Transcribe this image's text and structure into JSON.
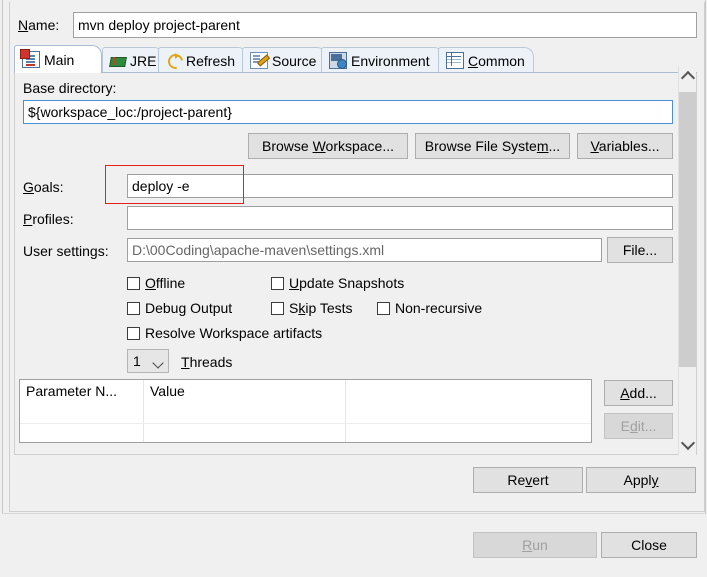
{
  "dialog": {
    "name_label": "Name:",
    "name_value": "mvn deploy project-parent"
  },
  "tabs": [
    {
      "label": "Main",
      "icon": "main-tab-icon",
      "selected": true
    },
    {
      "label": "JRE",
      "icon": "jre-tab-icon",
      "selected": false
    },
    {
      "label": "Refresh",
      "icon": "refresh-tab-icon",
      "selected": false
    },
    {
      "label": "Source",
      "icon": "source-tab-icon",
      "selected": false
    },
    {
      "label": "Environment",
      "icon": "environment-tab-icon",
      "selected": false
    },
    {
      "label": "Common",
      "icon": "common-tab-icon",
      "selected": false
    }
  ],
  "main_tab": {
    "base_directory_label": "Base directory:",
    "base_directory_value": "${workspace_loc:/project-parent}",
    "browse_workspace_label": "Browse Workspace...",
    "browse_file_system_label": "Browse File System...",
    "variables_label": "Variables...",
    "goals_label": "Goals:",
    "goals_value": "deploy -e",
    "profiles_label": "Profiles:",
    "profiles_value": "",
    "user_settings_label": "User settings:",
    "user_settings_value": "D:\\00Coding\\apache-maven\\settings.xml",
    "file_button_label": "File...",
    "checkboxes": [
      {
        "label": "Offline",
        "checked": false
      },
      {
        "label": "Update Snapshots",
        "checked": false
      },
      {
        "label": "Debug Output",
        "checked": false
      },
      {
        "label": "Skip Tests",
        "checked": false
      },
      {
        "label": "Non-recursive",
        "checked": false
      },
      {
        "label": "Resolve Workspace artifacts",
        "checked": false
      }
    ],
    "threads_value": "1",
    "threads_label": "Threads",
    "parameters_table": {
      "columns": [
        "Parameter N...",
        "Value",
        ""
      ],
      "rows": []
    },
    "add_button_label": "Add...",
    "edit_button_label": "Edit...",
    "edit_button_enabled": false
  },
  "footer": {
    "revert_label": "Revert",
    "apply_label": "Apply",
    "run_label": "Run",
    "run_enabled": false,
    "close_label": "Close"
  },
  "annotation": {
    "color": "#e8201c",
    "target": "goals-field"
  }
}
